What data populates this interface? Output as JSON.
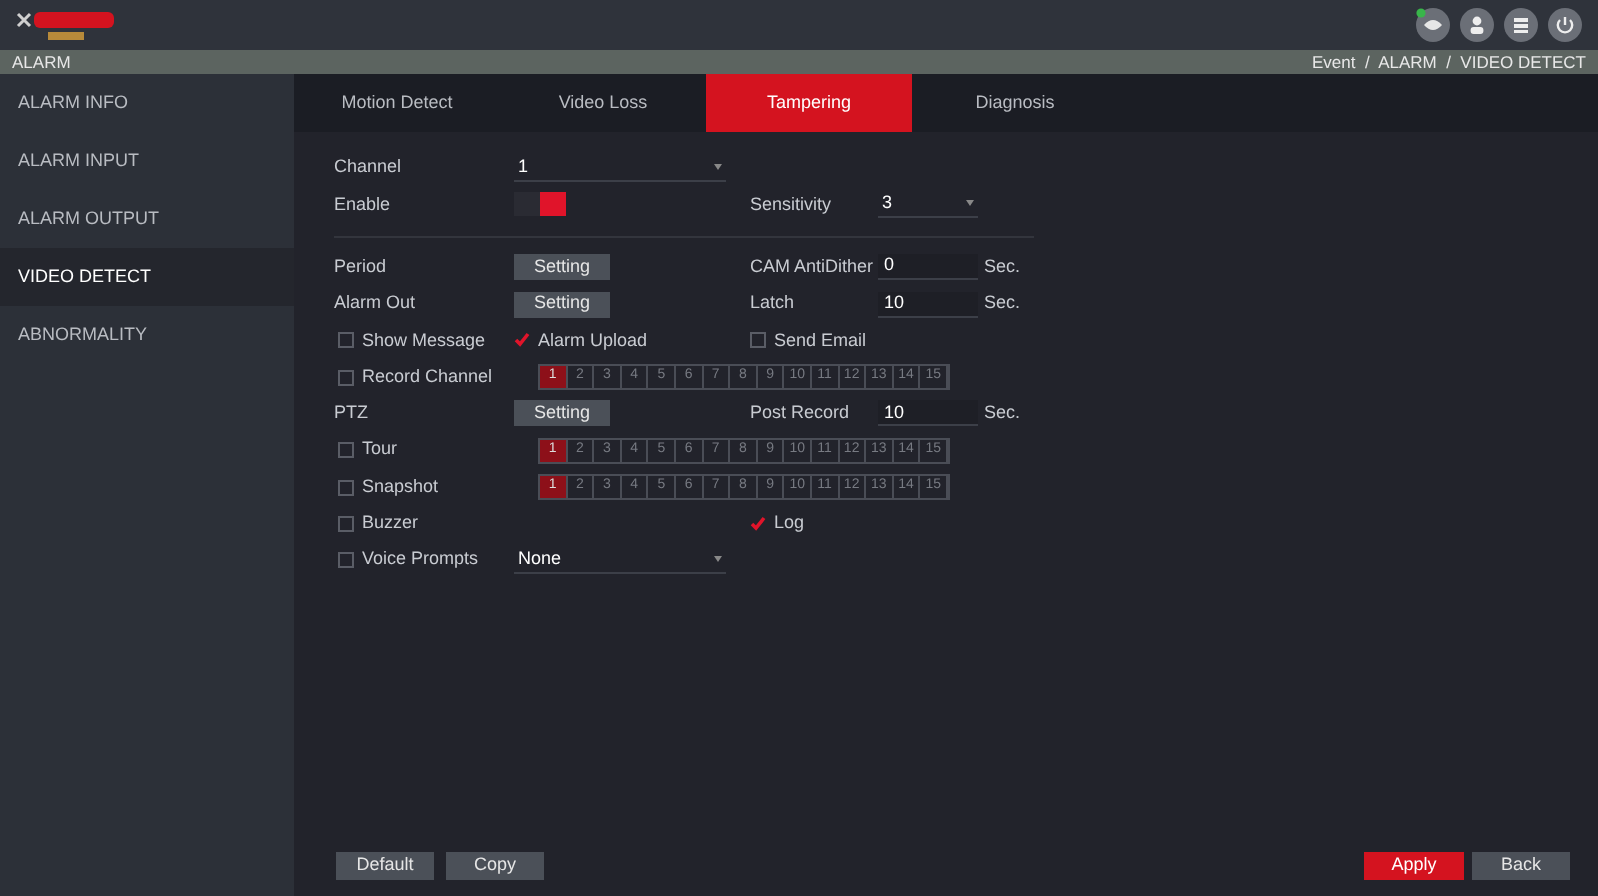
{
  "header": {
    "section": "ALARM",
    "breadcrumb": "Event  /  ALARM  /  VIDEO DETECT"
  },
  "sidebar": {
    "items": [
      {
        "label": "ALARM INFO",
        "selected": false
      },
      {
        "label": "ALARM INPUT",
        "selected": false
      },
      {
        "label": "ALARM OUTPUT",
        "selected": false
      },
      {
        "label": "VIDEO DETECT",
        "selected": true
      },
      {
        "label": "ABNORMALITY",
        "selected": false
      }
    ]
  },
  "tabs": [
    {
      "label": "Motion Detect",
      "selected": false
    },
    {
      "label": "Video Loss",
      "selected": false
    },
    {
      "label": "Tampering",
      "selected": true
    },
    {
      "label": "Diagnosis",
      "selected": false
    }
  ],
  "form": {
    "channel": {
      "label": "Channel",
      "value": "1"
    },
    "enable": {
      "label": "Enable",
      "on": true
    },
    "sensitivity": {
      "label": "Sensitivity",
      "value": "3"
    },
    "period": {
      "label": "Period",
      "button": "Setting"
    },
    "cam_antidither": {
      "label": "CAM AntiDither",
      "value": "0",
      "unit": "Sec."
    },
    "alarm_out": {
      "label": "Alarm Out",
      "button": "Setting"
    },
    "latch": {
      "label": "Latch",
      "value": "10",
      "unit": "Sec."
    },
    "show_message": {
      "label": "Show Message",
      "checked": false
    },
    "alarm_upload": {
      "label": "Alarm Upload",
      "checked": true
    },
    "send_email": {
      "label": "Send Email",
      "checked": false
    },
    "record_channel": {
      "label": "Record Channel",
      "checked": false,
      "channels": [
        {
          "label": "1",
          "selected": true
        },
        {
          "label": "2",
          "selected": false
        },
        {
          "label": "3",
          "selected": false
        },
        {
          "label": "4",
          "selected": false
        },
        {
          "label": "5",
          "selected": false
        },
        {
          "label": "6",
          "selected": false
        },
        {
          "label": "7",
          "selected": false
        },
        {
          "label": "8",
          "selected": false
        },
        {
          "label": "9",
          "selected": false
        },
        {
          "label": "10",
          "selected": false
        },
        {
          "label": "11",
          "selected": false
        },
        {
          "label": "12",
          "selected": false
        },
        {
          "label": "13",
          "selected": false
        },
        {
          "label": "14",
          "selected": false
        },
        {
          "label": "15",
          "selected": false
        }
      ]
    },
    "ptz": {
      "label": "PTZ",
      "button": "Setting"
    },
    "post_record": {
      "label": "Post Record",
      "value": "10",
      "unit": "Sec."
    },
    "tour": {
      "label": "Tour",
      "checked": false,
      "channels": [
        {
          "label": "1",
          "selected": true
        },
        {
          "label": "2",
          "selected": false
        },
        {
          "label": "3",
          "selected": false
        },
        {
          "label": "4",
          "selected": false
        },
        {
          "label": "5",
          "selected": false
        },
        {
          "label": "6",
          "selected": false
        },
        {
          "label": "7",
          "selected": false
        },
        {
          "label": "8",
          "selected": false
        },
        {
          "label": "9",
          "selected": false
        },
        {
          "label": "10",
          "selected": false
        },
        {
          "label": "11",
          "selected": false
        },
        {
          "label": "12",
          "selected": false
        },
        {
          "label": "13",
          "selected": false
        },
        {
          "label": "14",
          "selected": false
        },
        {
          "label": "15",
          "selected": false
        }
      ]
    },
    "snapshot": {
      "label": "Snapshot",
      "checked": false,
      "channels": [
        {
          "label": "1",
          "selected": true
        },
        {
          "label": "2",
          "selected": false
        },
        {
          "label": "3",
          "selected": false
        },
        {
          "label": "4",
          "selected": false
        },
        {
          "label": "5",
          "selected": false
        },
        {
          "label": "6",
          "selected": false
        },
        {
          "label": "7",
          "selected": false
        },
        {
          "label": "8",
          "selected": false
        },
        {
          "label": "9",
          "selected": false
        },
        {
          "label": "10",
          "selected": false
        },
        {
          "label": "11",
          "selected": false
        },
        {
          "label": "12",
          "selected": false
        },
        {
          "label": "13",
          "selected": false
        },
        {
          "label": "14",
          "selected": false
        },
        {
          "label": "15",
          "selected": false
        }
      ]
    },
    "buzzer": {
      "label": "Buzzer",
      "checked": false
    },
    "log": {
      "label": "Log",
      "checked": true
    },
    "voice_prompts": {
      "label": "Voice Prompts",
      "checked": false,
      "value": "None"
    }
  },
  "buttons": {
    "left": [
      "Default",
      "Copy"
    ],
    "apply": "Apply",
    "back": "Back"
  }
}
